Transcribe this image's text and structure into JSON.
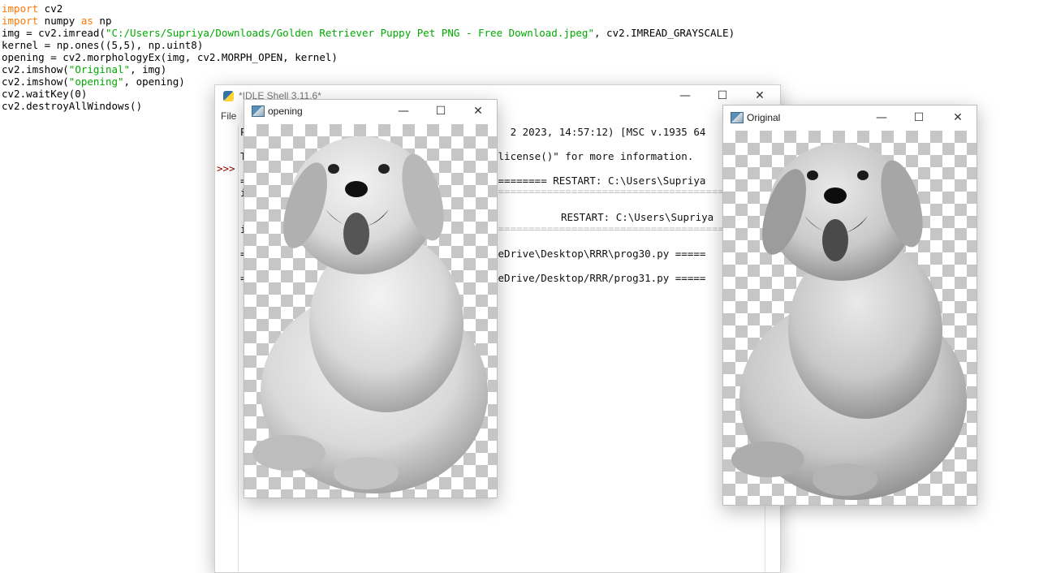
{
  "editor": {
    "lines": [
      [
        {
          "t": "import",
          "c": "kw"
        },
        {
          "t": " cv2",
          "c": ""
        }
      ],
      [
        {
          "t": "import",
          "c": "kw"
        },
        {
          "t": " numpy ",
          "c": ""
        },
        {
          "t": "as",
          "c": "kw"
        },
        {
          "t": " np",
          "c": ""
        }
      ],
      [
        {
          "t": "img = cv2.imread(",
          "c": ""
        },
        {
          "t": "\"C:/Users/Supriya/Downloads/Golden Retriever Puppy Pet PNG - Free Download.jpeg\"",
          "c": "str"
        },
        {
          "t": ", cv2.IMREAD_GRAYSCALE)",
          "c": ""
        }
      ],
      [
        {
          "t": "kernel = np.ones((5,5), np.uint8)",
          "c": ""
        }
      ],
      [
        {
          "t": "opening = cv2.morphologyEx(img, cv2.MORPH_OPEN, kernel)",
          "c": ""
        }
      ],
      [
        {
          "t": "cv2.imshow(",
          "c": ""
        },
        {
          "t": "\"Original\"",
          "c": "str"
        },
        {
          "t": ", img)",
          "c": ""
        }
      ],
      [
        {
          "t": "cv2.imshow(",
          "c": ""
        },
        {
          "t": "\"opening\"",
          "c": "str"
        },
        {
          "t": ", opening)",
          "c": ""
        }
      ],
      [
        {
          "t": "cv2.waitKey(0)",
          "c": ""
        }
      ],
      [
        {
          "t": "cv2.destroyAllWindows()",
          "c": ""
        }
      ]
    ]
  },
  "idle": {
    "title": "*IDLE Shell 3.11.6*",
    "menu_file": "File",
    "prompt": ">>>",
    "lines": [
      "t  2 2023, 14:57:12) [MSC v.1935 64",
      "\"license()\" for more information.",
      "========= RESTART: C:\\Users\\Supriya",
      "======================================",
      "RESTART: C:\\Users\\Supriya",
      "======================================",
      "neDrive\\Desktop\\RRR\\prog30.py =====",
      "neDrive/Desktop/RRR/prog31.py ====="
    ],
    "left_chars": [
      "P",
      "T",
      "=",
      "i",
      "i",
      "=",
      "="
    ]
  },
  "opening_window": {
    "title": "opening",
    "minimize": "—",
    "maximize": "☐",
    "close": "✕"
  },
  "original_window": {
    "title": "Original",
    "minimize": "—",
    "maximize": "☐",
    "close": "✕"
  }
}
